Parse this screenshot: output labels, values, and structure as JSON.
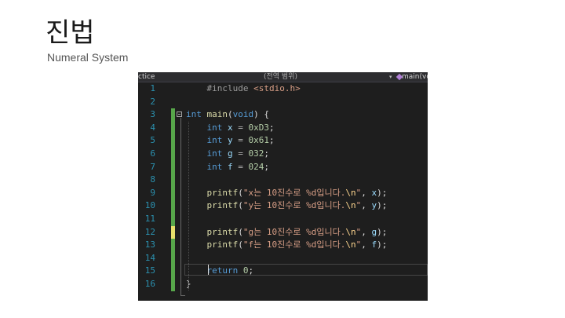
{
  "slide": {
    "title": "진법",
    "subtitle": "Numeral System"
  },
  "editor": {
    "nav": {
      "project": "ctice",
      "scope": "(전역 범위)",
      "caret": "▾",
      "function": "main(vo"
    },
    "lines": [
      {
        "n": "1",
        "change": "none",
        "tokens": [
          [
            "pp",
            "    #include "
          ],
          [
            "str",
            "<stdio.h>"
          ]
        ]
      },
      {
        "n": "2",
        "change": "none",
        "tokens": []
      },
      {
        "n": "3",
        "change": "saved",
        "tokens": [
          [
            "kw",
            "int"
          ],
          [
            "pn",
            " "
          ],
          [
            "fn",
            "main"
          ],
          [
            "pn",
            "("
          ],
          [
            "kw",
            "void"
          ],
          [
            "pn",
            ") {"
          ]
        ]
      },
      {
        "n": "4",
        "change": "saved",
        "tokens": [
          [
            "pn",
            "    "
          ],
          [
            "kw",
            "int"
          ],
          [
            "pn",
            " "
          ],
          [
            "var",
            "x"
          ],
          [
            "pn",
            " "
          ],
          [
            "op",
            "="
          ],
          [
            "pn",
            " "
          ],
          [
            "num",
            "0xD3"
          ],
          [
            "pn",
            ";"
          ]
        ]
      },
      {
        "n": "5",
        "change": "saved",
        "tokens": [
          [
            "pn",
            "    "
          ],
          [
            "kw",
            "int"
          ],
          [
            "pn",
            " "
          ],
          [
            "var",
            "y"
          ],
          [
            "pn",
            " "
          ],
          [
            "op",
            "="
          ],
          [
            "pn",
            " "
          ],
          [
            "num",
            "0x61"
          ],
          [
            "pn",
            ";"
          ]
        ]
      },
      {
        "n": "6",
        "change": "saved",
        "tokens": [
          [
            "pn",
            "    "
          ],
          [
            "kw",
            "int"
          ],
          [
            "pn",
            " "
          ],
          [
            "var",
            "g"
          ],
          [
            "pn",
            " "
          ],
          [
            "op",
            "="
          ],
          [
            "pn",
            " "
          ],
          [
            "num",
            "032"
          ],
          [
            "pn",
            ";"
          ]
        ]
      },
      {
        "n": "7",
        "change": "saved",
        "tokens": [
          [
            "pn",
            "    "
          ],
          [
            "kw",
            "int"
          ],
          [
            "pn",
            " "
          ],
          [
            "var",
            "f"
          ],
          [
            "pn",
            " "
          ],
          [
            "op",
            "="
          ],
          [
            "pn",
            " "
          ],
          [
            "num",
            "024"
          ],
          [
            "pn",
            ";"
          ]
        ]
      },
      {
        "n": "8",
        "change": "saved",
        "tokens": []
      },
      {
        "n": "9",
        "change": "saved",
        "tokens": [
          [
            "pn",
            "    "
          ],
          [
            "fn",
            "printf"
          ],
          [
            "pn",
            "("
          ],
          [
            "str",
            "\"x는 10진수로 %d입니다."
          ],
          [
            "esc",
            "\\n"
          ],
          [
            "str",
            "\""
          ],
          [
            "pn",
            ", "
          ],
          [
            "var",
            "x"
          ],
          [
            "pn",
            ");"
          ]
        ]
      },
      {
        "n": "10",
        "change": "saved",
        "tokens": [
          [
            "pn",
            "    "
          ],
          [
            "fn",
            "printf"
          ],
          [
            "pn",
            "("
          ],
          [
            "str",
            "\"y는 10진수로 %d입니다."
          ],
          [
            "esc",
            "\\n"
          ],
          [
            "str",
            "\""
          ],
          [
            "pn",
            ", "
          ],
          [
            "var",
            "y"
          ],
          [
            "pn",
            ");"
          ]
        ]
      },
      {
        "n": "11",
        "change": "saved",
        "tokens": []
      },
      {
        "n": "12",
        "change": "unsaved",
        "tokens": [
          [
            "pn",
            "    "
          ],
          [
            "fn",
            "printf"
          ],
          [
            "pn",
            "("
          ],
          [
            "str",
            "\"g는 10진수로 %d입니다."
          ],
          [
            "esc",
            "\\n"
          ],
          [
            "str",
            "\""
          ],
          [
            "pn",
            ", "
          ],
          [
            "var",
            "g"
          ],
          [
            "pn",
            ");"
          ]
        ]
      },
      {
        "n": "13",
        "change": "saved",
        "tokens": [
          [
            "pn",
            "    "
          ],
          [
            "fn",
            "printf"
          ],
          [
            "pn",
            "("
          ],
          [
            "str",
            "\"f는 10진수로 %d입니다."
          ],
          [
            "esc",
            "\\n"
          ],
          [
            "str",
            "\""
          ],
          [
            "pn",
            ", "
          ],
          [
            "var",
            "f"
          ],
          [
            "pn",
            ");"
          ]
        ]
      },
      {
        "n": "14",
        "change": "saved",
        "tokens": []
      },
      {
        "n": "15",
        "change": "saved",
        "tokens": [
          [
            "pn",
            "    "
          ],
          [
            "kw",
            "return"
          ],
          [
            "pn",
            " "
          ],
          [
            "num",
            "0"
          ],
          [
            "pn",
            ";"
          ]
        ]
      },
      {
        "n": "16",
        "change": "saved",
        "tokens": [
          [
            "pn",
            "}"
          ]
        ]
      }
    ]
  }
}
